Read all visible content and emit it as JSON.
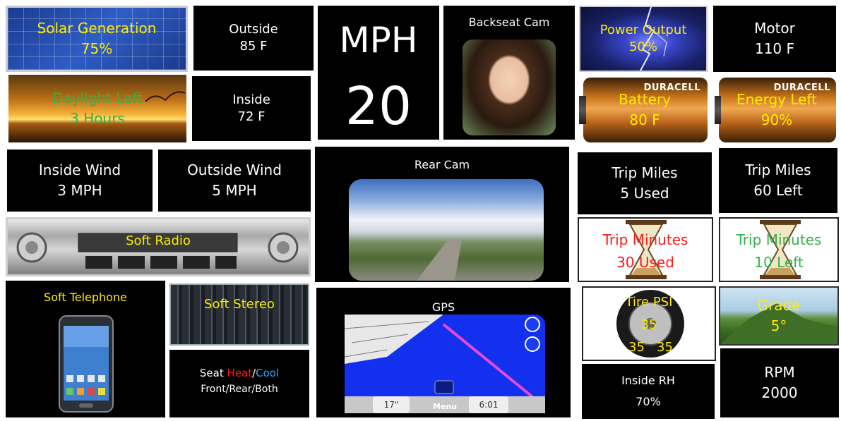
{
  "solar": {
    "label": "Solar Generation",
    "value": "75%"
  },
  "outside": {
    "label": "Outside",
    "value": "85 F"
  },
  "mph": {
    "label": "MPH",
    "value": "20"
  },
  "backseat_cam": {
    "label": "Backseat Cam"
  },
  "power_output": {
    "label": "Power Output",
    "value": "50%"
  },
  "motor": {
    "label": "Motor",
    "value": "110 F"
  },
  "daylight": {
    "label": "Daylight Left",
    "value": "3 Hours"
  },
  "inside": {
    "label": "Inside",
    "value": "72 F"
  },
  "battery": {
    "label": "Battery",
    "value": "80 F",
    "brand": "DURACELL"
  },
  "energy_left": {
    "label": "Energy Left",
    "value": "90%",
    "brand": "DURACELL"
  },
  "inside_wind": {
    "label": "Inside Wind",
    "value": "3 MPH"
  },
  "outside_wind": {
    "label": "Outside Wind",
    "value": "5 MPH"
  },
  "rear_cam": {
    "label": "Rear Cam"
  },
  "trip_miles_used": {
    "label": "Trip Miles",
    "value": "5 Used"
  },
  "trip_miles_left": {
    "label": "Trip Miles",
    "value": "60 Left"
  },
  "soft_radio": {
    "label": "Soft Radio"
  },
  "trip_minutes_used": {
    "label": "Trip Minutes",
    "value": "30 Used"
  },
  "trip_minutes_left": {
    "label": "Trip Minutes",
    "value": "10 Left"
  },
  "soft_telephone": {
    "label": "Soft Telephone"
  },
  "soft_stereo": {
    "label": "Soft Stereo"
  },
  "gps": {
    "label": "GPS",
    "menu": "Menu",
    "speed": "17\"",
    "time": "6:01"
  },
  "tire_psi": {
    "label": "Tire PSI",
    "front": "35",
    "rear_left": "35",
    "rear_right": "35"
  },
  "grade": {
    "label": "Grade",
    "value": "5°"
  },
  "seat": {
    "label_seat": "Seat ",
    "label_heat": "Heat",
    "label_slash": "/",
    "label_cool": "Cool",
    "options": "Front/Rear/Both"
  },
  "inside_rh": {
    "label": "Inside RH",
    "value": "70%"
  },
  "rpm": {
    "label": "RPM",
    "value": "2000"
  },
  "colors": {
    "yellow": "#ffeb00",
    "green": "#35b04a",
    "red": "#ff1a1a",
    "blue": "#2fa8ff"
  }
}
